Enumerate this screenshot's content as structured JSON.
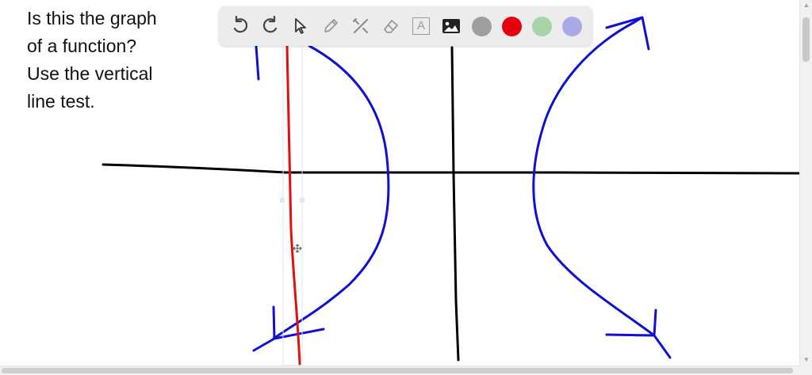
{
  "question": {
    "lines": [
      "Is this the graph",
      "of a function?",
      "Use the vertical",
      "line test."
    ]
  },
  "toolbar": {
    "tools": [
      {
        "name": "undo-icon"
      },
      {
        "name": "redo-icon"
      },
      {
        "name": "select-pointer-icon"
      },
      {
        "name": "pen-icon"
      },
      {
        "name": "tools-icon"
      },
      {
        "name": "eraser-icon"
      },
      {
        "name": "text-box-icon",
        "label": "A"
      },
      {
        "name": "image-icon"
      }
    ],
    "colors": [
      {
        "name": "color-gray",
        "hex": "#9e9e9e"
      },
      {
        "name": "color-red",
        "hex": "#e8000f"
      },
      {
        "name": "color-green",
        "hex": "#a8d4a8"
      },
      {
        "name": "color-lavender",
        "hex": "#a9a9e6"
      }
    ]
  },
  "drawing": {
    "axis_color": "#000000",
    "curve_color": "#1010d0",
    "test_line_color": "#e01010"
  }
}
